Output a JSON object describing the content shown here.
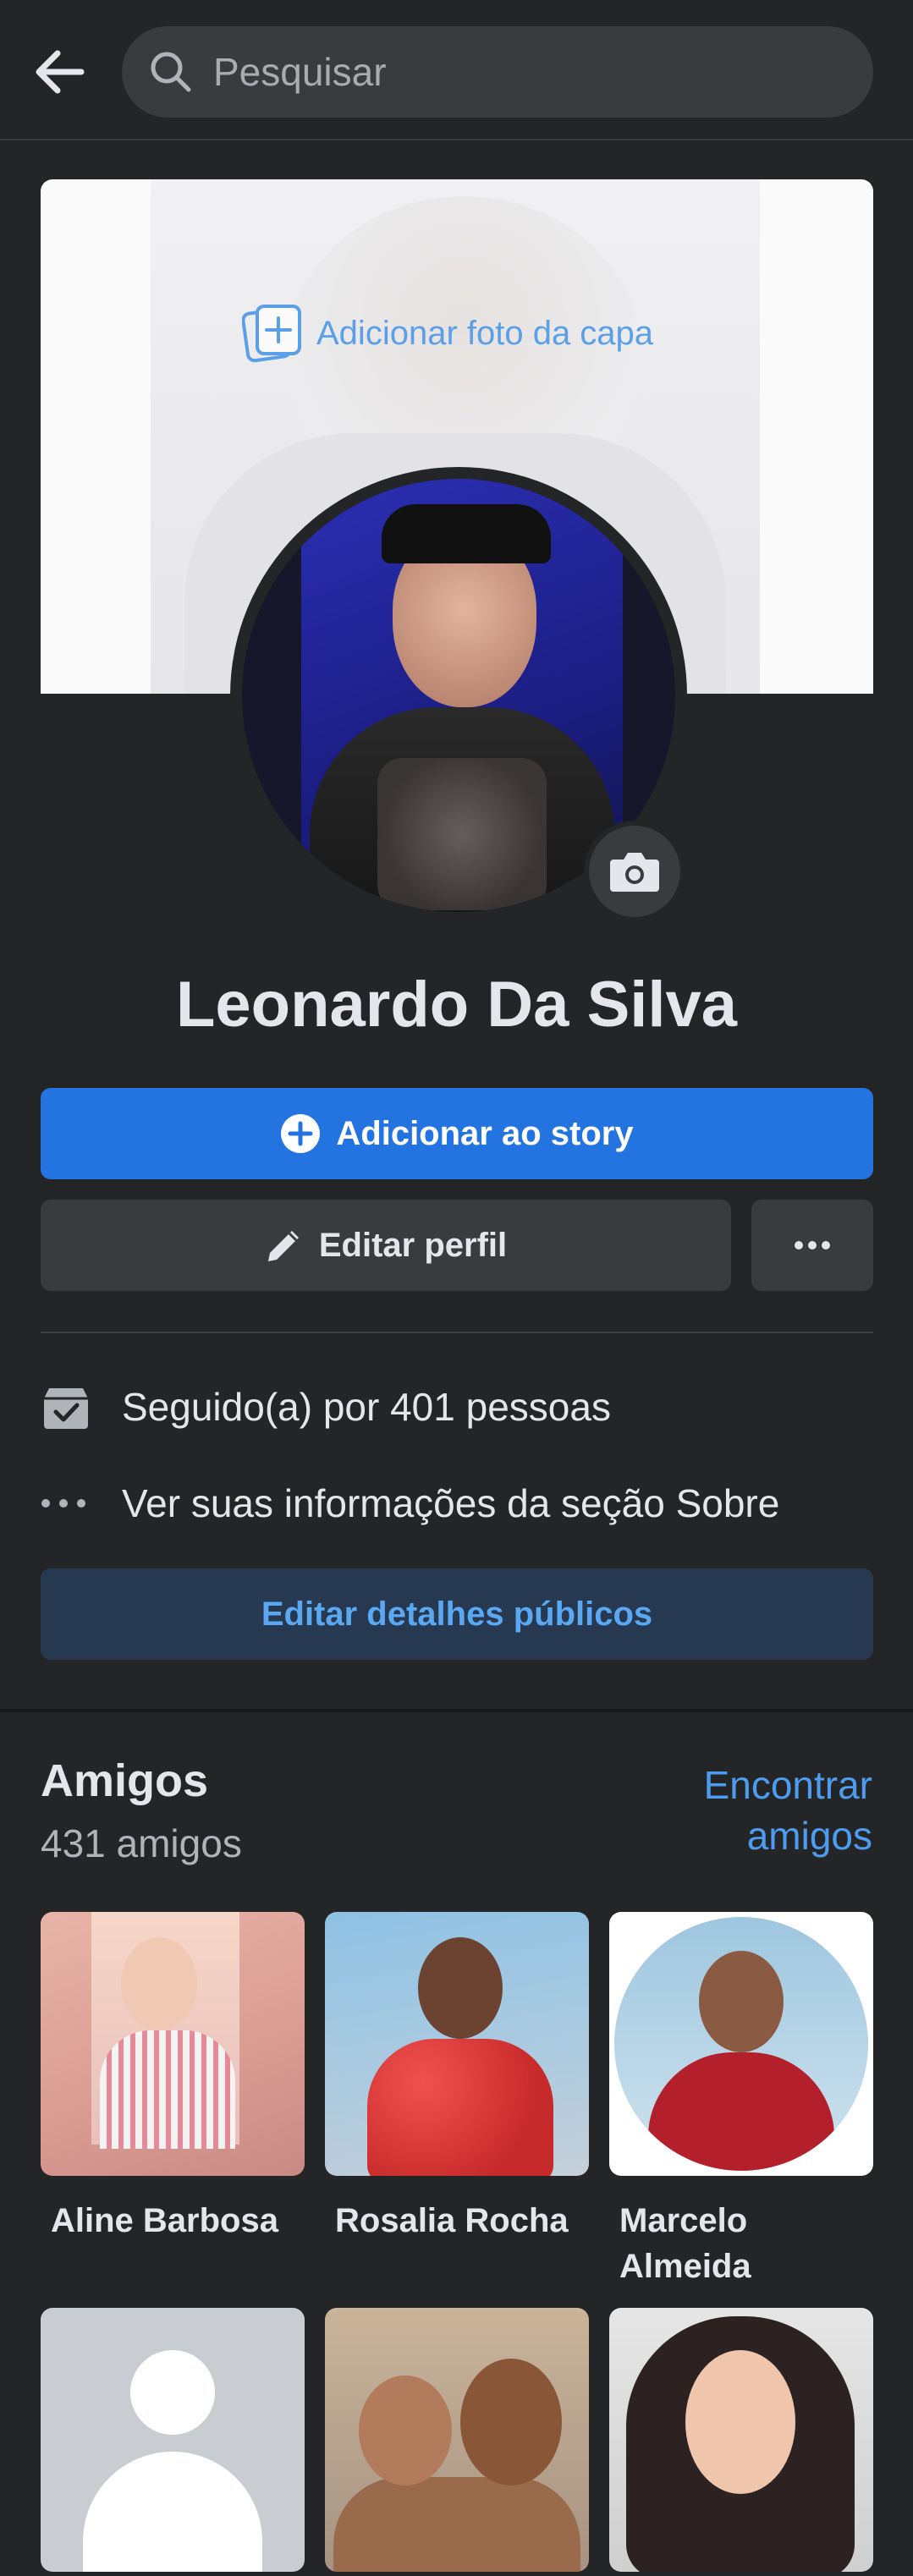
{
  "search": {
    "placeholder": "Pesquisar"
  },
  "cover": {
    "add_cover_label": "Adicionar foto da capa"
  },
  "profile": {
    "name": "Leonardo Da Silva"
  },
  "actions": {
    "add_story_label": "Adicionar ao story",
    "edit_profile_label": "Editar perfil"
  },
  "info": {
    "followers_text": "Seguido(a) por 401 pessoas",
    "about_text": "Ver suas informações da seção Sobre",
    "edit_details_label": "Editar detalhes públicos"
  },
  "friends": {
    "title": "Amigos",
    "count_text": "431 amigos",
    "find_line1": "Encontrar",
    "find_line2": "amigos",
    "items": [
      {
        "name": "Aline Barbosa"
      },
      {
        "name": "Rosalia Rocha"
      },
      {
        "name_line1": "Marcelo",
        "name_line2": "Almeida"
      },
      {
        "name": ""
      },
      {
        "name": ""
      },
      {
        "name": ""
      }
    ]
  },
  "colors": {
    "background": "#242526",
    "primary_button": "#2374e1",
    "secondary_button": "#3a3b3c",
    "details_button": "#263951",
    "link": "#4d9cf0"
  },
  "icons": {
    "back": "arrow-left-icon",
    "search": "search-icon",
    "add_cover": "add-photo-icon",
    "camera": "camera-icon",
    "add_story": "plus-circle-icon",
    "edit": "pencil-icon",
    "more": "more-dots-icon",
    "followers": "followers-icon",
    "about": "ellipsis-icon"
  }
}
